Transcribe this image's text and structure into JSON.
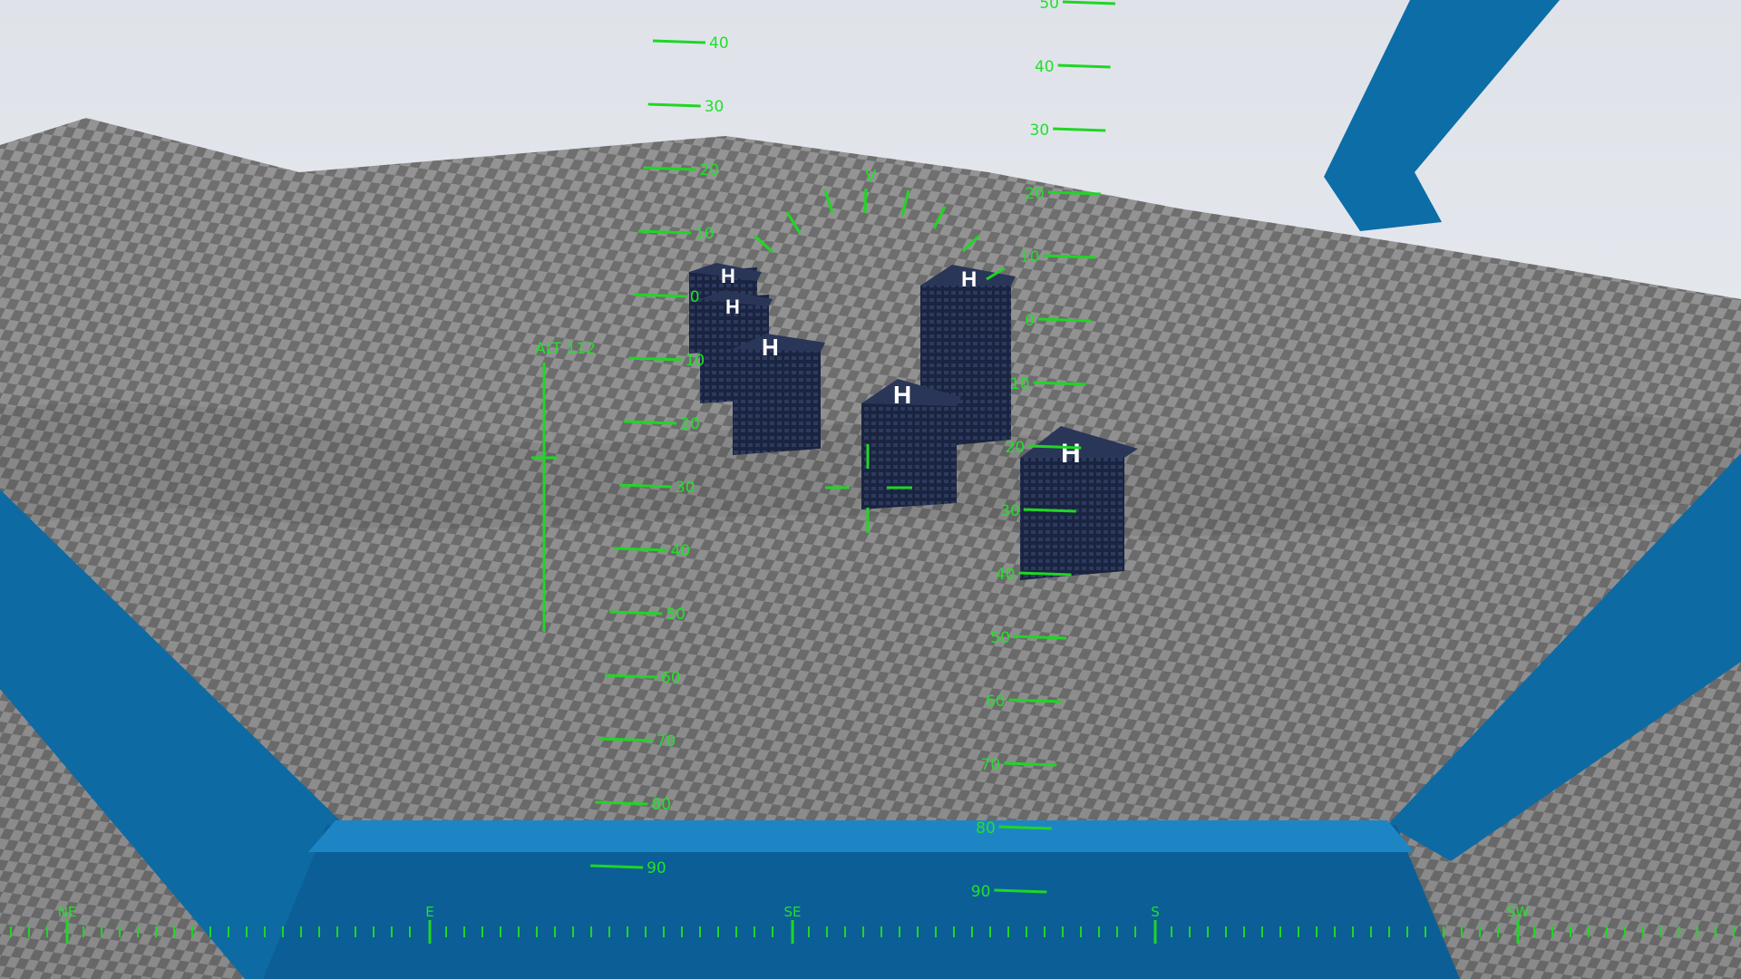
{
  "colors": {
    "hud": "#22e02a",
    "sky": "#e6eaef",
    "terrain_light": "#9a9a9a",
    "terrain_dark": "#6d6d6d",
    "cockpit_frame": "#0f6fa8",
    "building": "#1c2740",
    "helipad_mark": "#ffffff"
  },
  "altitude": {
    "label": "ALT 112",
    "value": 112
  },
  "pitch_ladder_left": {
    "labels": [
      "40",
      "30",
      "20",
      "10",
      "0",
      "10",
      "20",
      "30",
      "40",
      "50",
      "60",
      "70",
      "80",
      "90"
    ]
  },
  "pitch_ladder_right": {
    "labels": [
      "50",
      "40",
      "30",
      "20",
      "10",
      "0",
      "10",
      "20",
      "30",
      "40",
      "50",
      "60",
      "70",
      "80",
      "90"
    ]
  },
  "bank_indicator": {
    "label": "V"
  },
  "compass": {
    "headings": [
      "NE",
      "E",
      "SE",
      "S",
      "SW"
    ]
  },
  "buildings": [
    {
      "label": "H"
    },
    {
      "label": "H"
    },
    {
      "label": "H"
    },
    {
      "label": "H"
    },
    {
      "label": "H"
    },
    {
      "label": "H"
    }
  ]
}
